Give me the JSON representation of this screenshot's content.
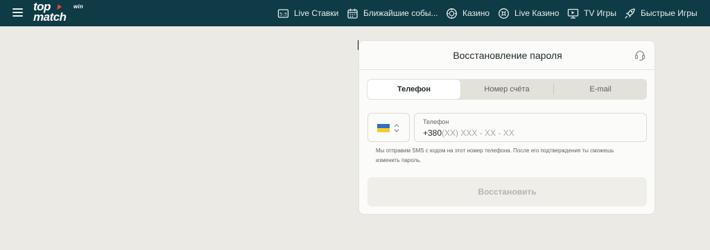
{
  "header": {
    "logo": {
      "line1": "top",
      "line2": "match",
      "suffix": "win"
    },
    "nav": [
      {
        "label": "Live Ставки",
        "icon": "scoreboard-icon"
      },
      {
        "label": "Ближайшие собы...",
        "icon": "calendar-icon"
      },
      {
        "label": "Казино",
        "icon": "casino-chip-icon"
      },
      {
        "label": "Live Казино",
        "icon": "live-casino-icon"
      },
      {
        "label": "TV Игры",
        "icon": "tv-icon"
      },
      {
        "label": "Быстрые Игры",
        "icon": "rocket-icon"
      }
    ]
  },
  "card": {
    "title": "Восстановление пароля",
    "support_icon": "support-headset-icon",
    "tabs": [
      {
        "label": "Телефон",
        "active": true
      },
      {
        "label": "Номер счёта",
        "active": false
      },
      {
        "label": "E-mail",
        "active": false
      }
    ],
    "country": {
      "flag": "ua-flag-icon",
      "icon": "chevron-updown-icon"
    },
    "phone": {
      "label": "Телефон",
      "prefix": "+380",
      "placeholder": "(XX) XXX - XX - XX"
    },
    "hint": "Мы отправим SMS с кодом на этот номер телефона. После его подтверждения ты сможешь изменить пароль.",
    "submit_label": "Восстановить"
  },
  "colors": {
    "header_bg": "#0e3b45",
    "page_bg": "#ebeae4",
    "card_bg": "#fbfbf9",
    "logo_accent": "#e64a2e"
  }
}
